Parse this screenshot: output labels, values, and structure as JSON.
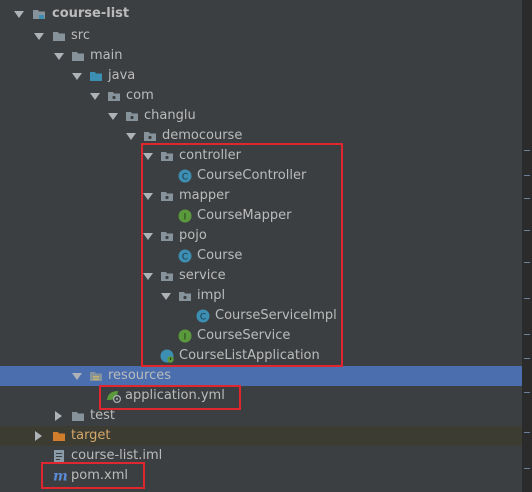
{
  "tree": {
    "project": "course-list",
    "src": "src",
    "main": "main",
    "java": "java",
    "com": "com",
    "changlu": "changlu",
    "democourse": "democourse",
    "controller": "controller",
    "course_controller": "CourseController",
    "mapper": "mapper",
    "course_mapper": "CourseMapper",
    "pojo": "pojo",
    "course": "Course",
    "service": "service",
    "impl": "impl",
    "course_service_impl": "CourseServiceImpl",
    "course_service": "CourseService",
    "course_list_application": "CourseListApplication",
    "resources": "resources",
    "application_yml": "application.yml",
    "test": "test",
    "target": "target",
    "iml": "course-list.iml",
    "pom": "pom.xml"
  },
  "badges": {
    "class": "C",
    "interface": "I",
    "maven": "m"
  },
  "colors": {
    "background": "#3c3f41",
    "selection": "#4b6eaf",
    "highlight_box": "#e0262e",
    "class_icon": "#3c8fb3",
    "interface_icon": "#5a9a3c",
    "maven_icon": "#5b8ad6",
    "target_folder": "#d17d2c"
  }
}
